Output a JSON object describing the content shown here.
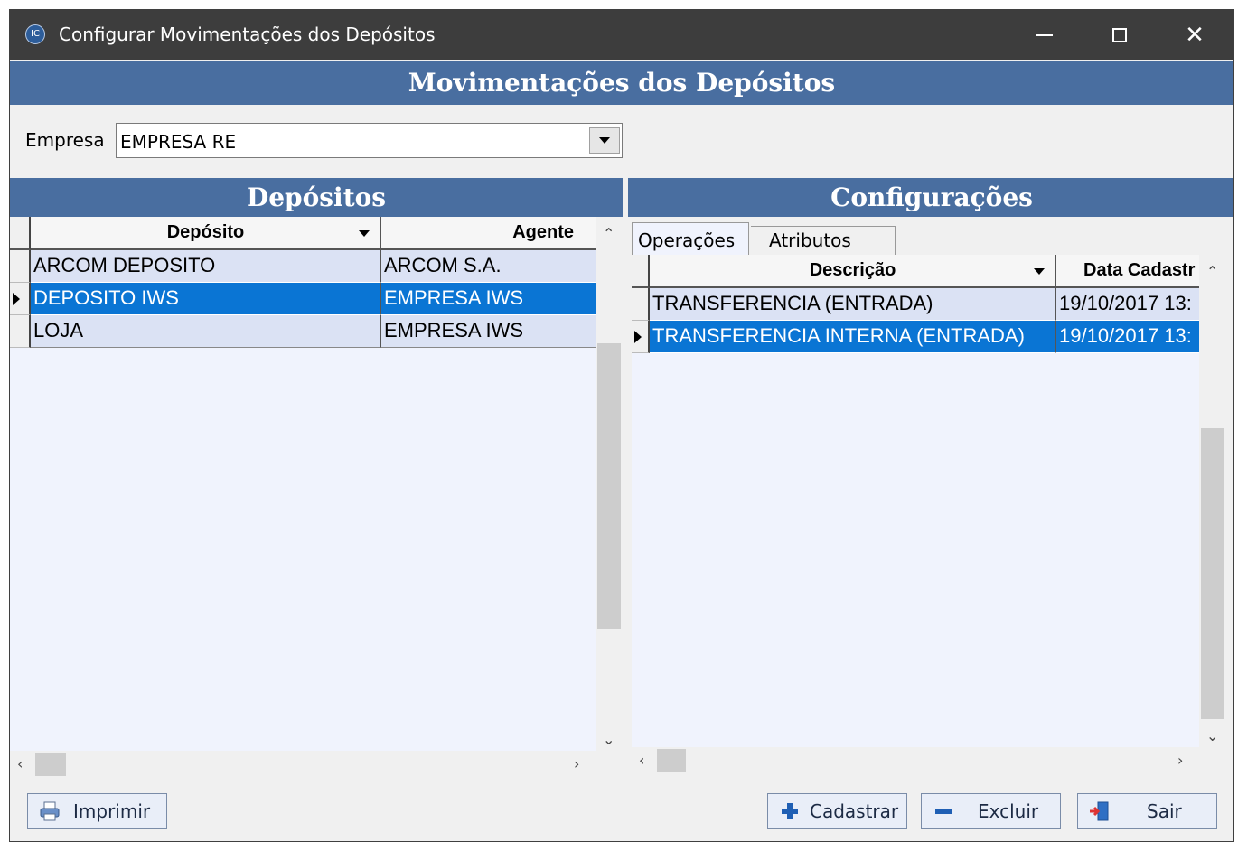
{
  "window": {
    "title": "Configurar Movimentações dos Depósitos",
    "app_icon_text": "IC"
  },
  "header": {
    "title": "Movimentações dos Depósitos"
  },
  "empresa": {
    "label": "Empresa",
    "value": "EMPRESA RE"
  },
  "depositos": {
    "title": "Depósitos",
    "columns": [
      "Depósito",
      "Agente"
    ],
    "rows": [
      {
        "deposito": "ARCOM DEPOSITO",
        "agente": "ARCOM S.A."
      },
      {
        "deposito": "DEPOSITO IWS",
        "agente": "EMPRESA IWS"
      },
      {
        "deposito": "LOJA",
        "agente": "EMPRESA IWS"
      }
    ],
    "selected_row": 1
  },
  "configuracoes": {
    "title": "Configurações",
    "tabs": [
      "Operações",
      "Atributos"
    ],
    "active_tab": "Operações",
    "columns": [
      "Descrição",
      "Data Cadastr"
    ],
    "rows": [
      {
        "descricao": "TRANSFERENCIA (ENTRADA)",
        "data": "19/10/2017 13:"
      },
      {
        "descricao": "TRANSFERENCIA INTERNA (ENTRADA)",
        "data": "19/10/2017 13:"
      }
    ],
    "selected_row": 1
  },
  "buttons": {
    "imprimir": "Imprimir",
    "cadastrar": "Cadastrar",
    "excluir": "Excluir",
    "sair": "Sair"
  },
  "colors": {
    "header_band": "#496ea0",
    "selection": "#0a75d4",
    "titlebar": "#3d3d3d"
  }
}
